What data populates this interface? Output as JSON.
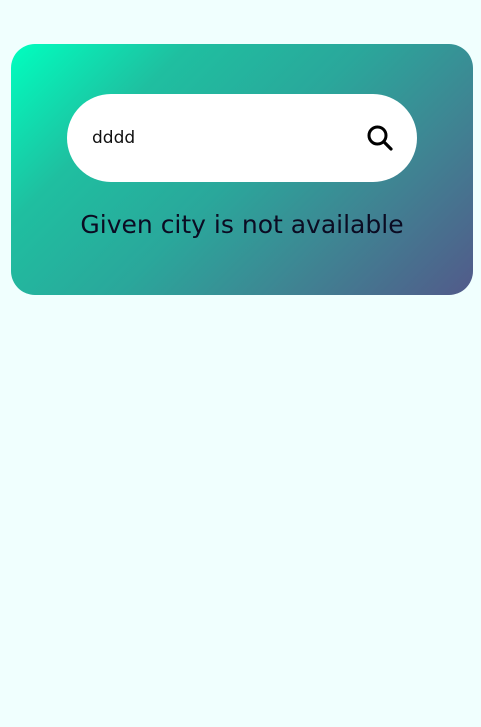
{
  "search": {
    "value": "dddd",
    "button_icon": "search-icon"
  },
  "status": {
    "message": "Given city is not available"
  },
  "colors": {
    "page_background": "#f0fffe",
    "card_gradient_start": "#00ffbf",
    "card_gradient_end": "#525a8a",
    "search_bar_background": "#ffffff",
    "text": "#0b0b22"
  }
}
